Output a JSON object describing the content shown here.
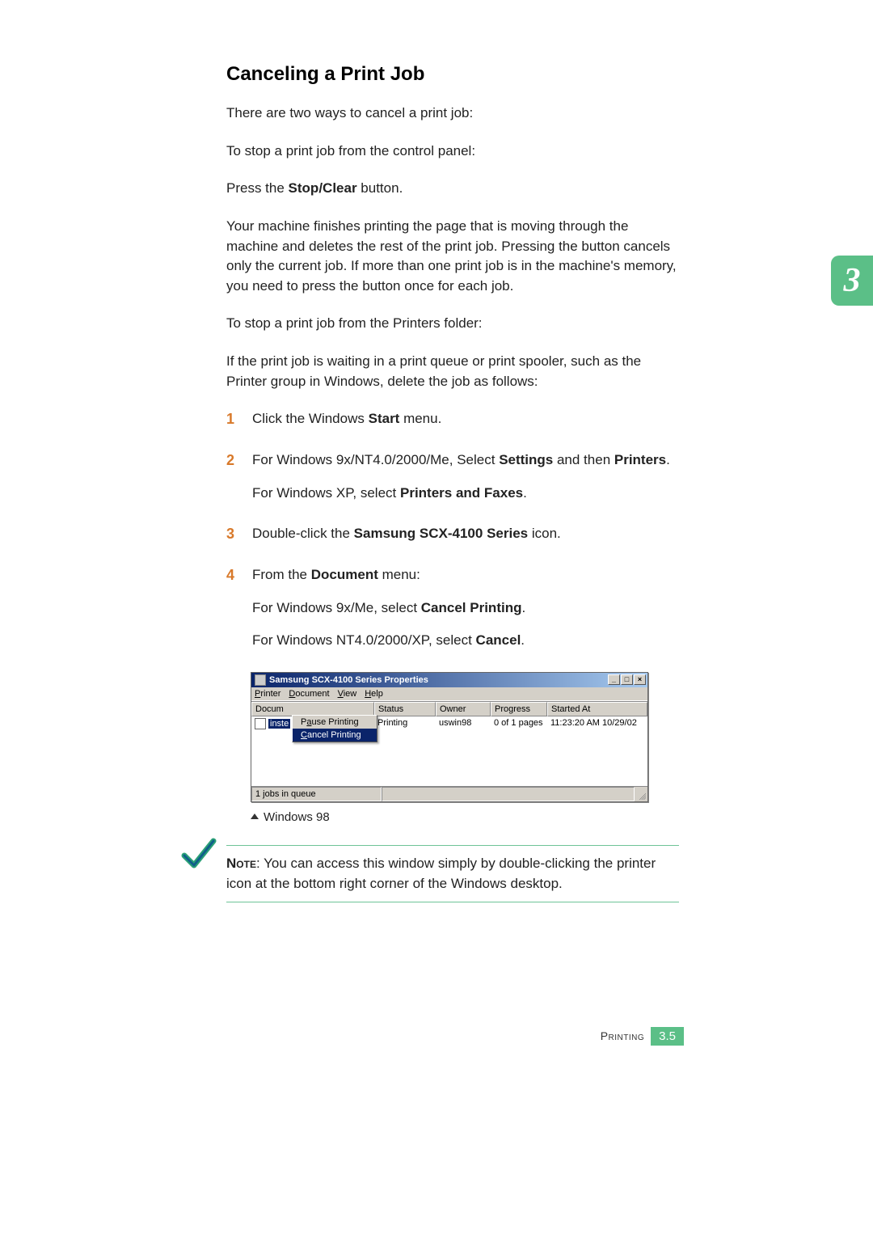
{
  "chapter_tab": "3",
  "title": "Canceling a Print Job",
  "intro1": "There are two ways to cancel a print job:",
  "intro2": "To stop a print job from the control panel:",
  "press_pre": "Press the ",
  "press_bold": "Stop/Clear",
  "press_post": " button.",
  "para_finish": "Your machine finishes printing the page that is moving through the machine and deletes the rest of the print job. Pressing the button cancels only the current job. If more than one print job is in the machine's memory, you need to press the button once for each job.",
  "intro3": "To stop a print job from the Printers folder:",
  "intro4": "If the print job is waiting in a print queue or print spooler, such as the Printer group in Windows, delete the job as follows:",
  "steps": {
    "s1_num": "1",
    "s1_pre": "Click the Windows ",
    "s1_bold": "Start",
    "s1_post": " menu.",
    "s2_num": "2",
    "s2_pre": "For Windows 9x/NT4.0/2000/Me, Select ",
    "s2_bold1": "Settings",
    "s2_mid": " and then ",
    "s2_bold2": "Printers",
    "s2_post": ".",
    "s2b_pre": "For Windows XP, select ",
    "s2b_bold": "Printers and Faxes",
    "s2b_post": ".",
    "s3_num": "3",
    "s3_pre": "Double-click the  ",
    "s3_bold": "Samsung SCX-4100 Series",
    "s3_post": " icon.",
    "s4_num": "4",
    "s4_pre": "From the ",
    "s4_bold": "Document",
    "s4_post": " menu:",
    "s4a_pre": "For Windows 9x/Me, select ",
    "s4a_bold": "Cancel Printing",
    "s4a_post": ".",
    "s4b_pre": "For Windows NT4.0/2000/XP, select ",
    "s4b_bold": "Cancel",
    "s4b_post": "."
  },
  "screenshot": {
    "title": "Samsung SCX-4100 Series Properties",
    "menus": {
      "printer": "Printer",
      "document": "Document",
      "view": "View",
      "help": "Help"
    },
    "dropdown": {
      "pause": "Pause Printing",
      "cancel": "Cancel Printing"
    },
    "columns": {
      "document": "Docum",
      "status": "Status",
      "owner": "Owner",
      "progress": "Progress",
      "started": "Started At"
    },
    "row1": {
      "docname_prefix": "inste",
      "status": "Printing",
      "owner": "uswin98",
      "progress": "0 of 1 pages",
      "started": "11:23:20 AM 10/29/02"
    },
    "statusbar": "1 jobs in queue",
    "btn_min": "_",
    "btn_max": "□",
    "btn_close": "×"
  },
  "caption": "Windows 98",
  "note": {
    "label": "Note",
    "text": ": You can access this window simply by double-clicking the printer icon at the bottom right corner of the Windows desktop."
  },
  "footer": {
    "label": "Printing",
    "page": "3.5"
  }
}
